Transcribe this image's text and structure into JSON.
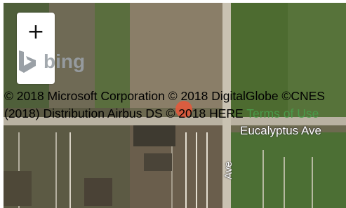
{
  "map": {
    "streets": [
      "Eucalyptus Ave",
      "Ave"
    ],
    "colors": {
      "field_green": "#5e7a3e",
      "field_brown": "#7a6e58",
      "road": "#c8c0b0",
      "marker": "#e25a3c"
    }
  },
  "controls": {
    "zoom_in_label": "+",
    "logo_text": "bing"
  },
  "attribution": {
    "line": "© 2018 Microsoft Corporation © 2018 DigitalGlobe ©CNES (2018) Distribution Airbus DS © 2018 HERE",
    "terms_link": "Terms of Use"
  }
}
